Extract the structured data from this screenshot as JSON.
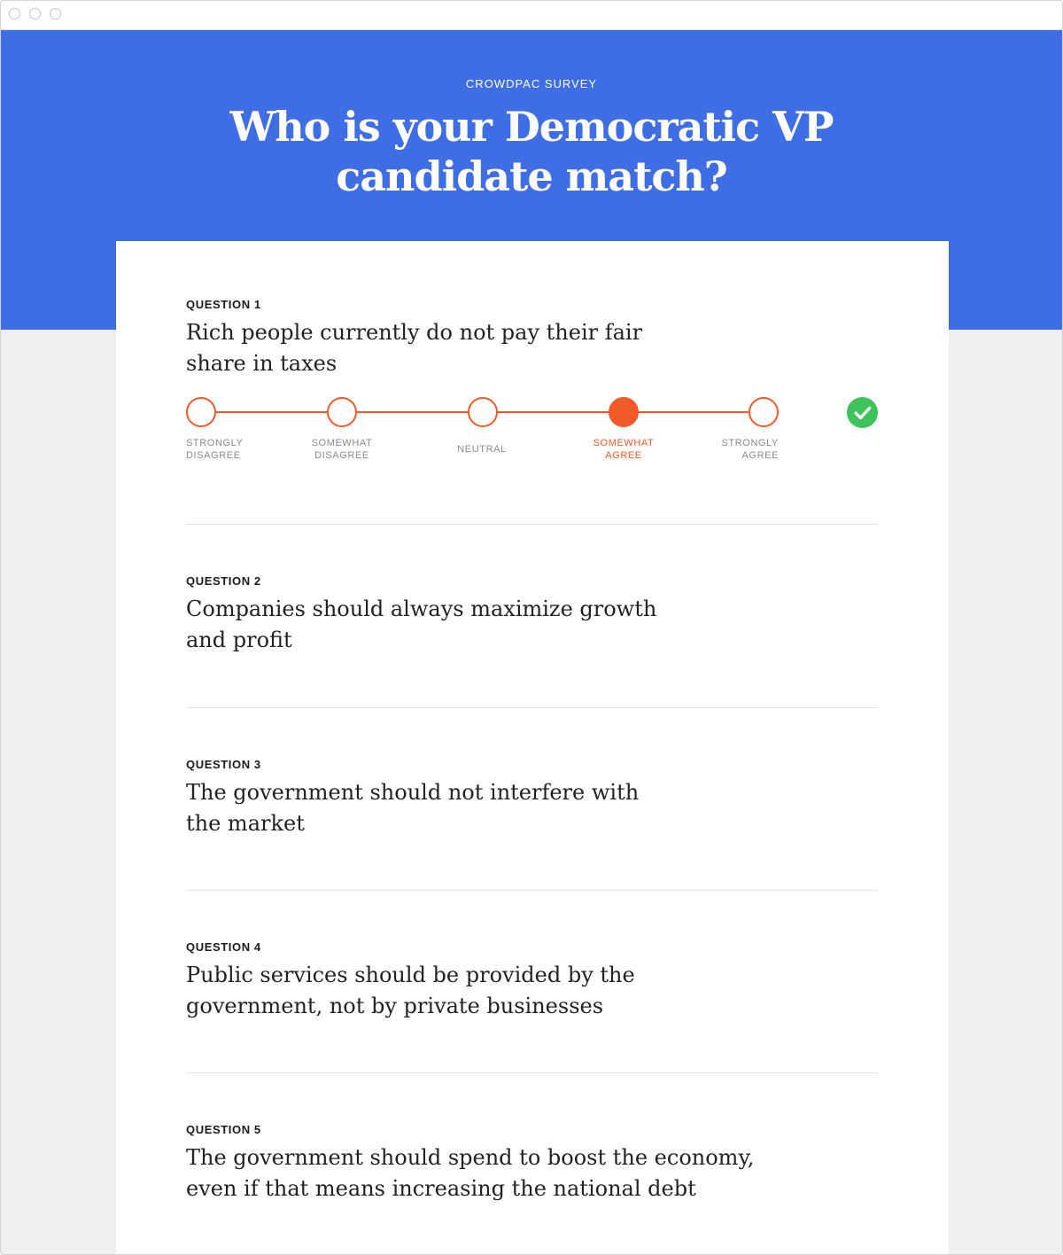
{
  "header": {
    "eyebrow": "CROWDPAC SURVEY",
    "title": "Who is your Democratic VP candidate match?"
  },
  "scale": {
    "options": [
      "STRONGLY DISAGREE",
      "SOMEWHAT DISAGREE",
      "NEUTRAL",
      "SOMEWHAT AGREE",
      "STRONGLY AGREE"
    ],
    "options_lines": [
      [
        "STRONGLY",
        "DISAGREE"
      ],
      [
        "SOMEWHAT",
        "DISAGREE"
      ],
      [
        "NEUTRAL"
      ],
      [
        "SOMEWHAT",
        "AGREE"
      ],
      [
        "STRONGLY",
        "AGREE"
      ]
    ]
  },
  "questions": [
    {
      "label": "QUESTION 1",
      "text": "Rich people currently do not pay their fair share in taxes",
      "lines": [
        "Rich people currently do not pay their fair",
        "share in taxes"
      ],
      "selected": "SOMEWHAT AGREE",
      "answered": true
    },
    {
      "label": "QUESTION 2",
      "text": "Companies should always maximize growth and profit",
      "lines": [
        "Companies should always maximize growth",
        "and profit"
      ]
    },
    {
      "label": "QUESTION 3",
      "text": "The government should not interfere with the market",
      "lines": [
        "The government should not interfere with",
        "the market"
      ]
    },
    {
      "label": "QUESTION 4",
      "text": "Public services should be provided by the government, not by private businesses",
      "lines": [
        "Public services should be provided by the",
        "government, not by private businesses"
      ]
    },
    {
      "label": "QUESTION 5",
      "text": "The government should spend to boost the economy, even if that means increasing the national debt",
      "lines": [
        "The government should spend to boost the economy,",
        "even if that means increasing the national debt"
      ]
    }
  ],
  "colors": {
    "hero": "#3f6de3",
    "accent": "#f05a28",
    "check": "#3ec25a",
    "page_bg": "#efefef"
  },
  "icons": {
    "answered": "check-circle-icon"
  }
}
